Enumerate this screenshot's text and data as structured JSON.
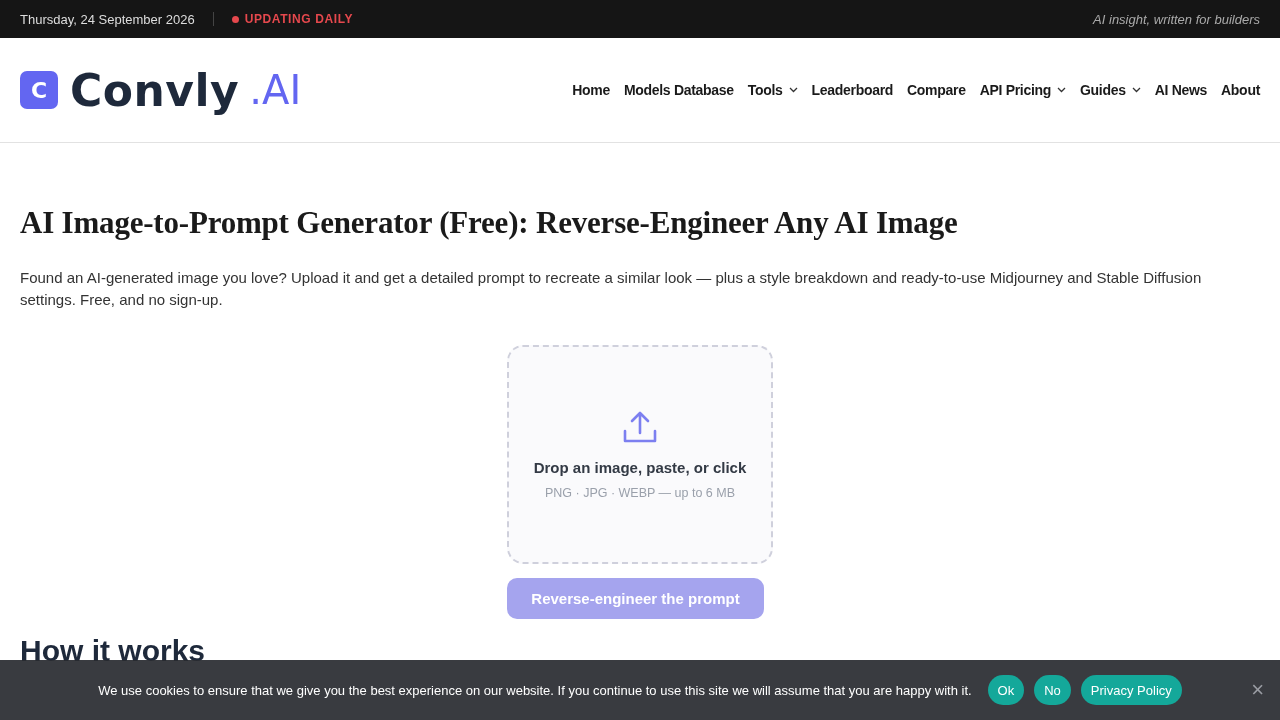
{
  "top_bar": {
    "date": "Thursday, 24 September 2026",
    "status": "UPDATING DAILY",
    "tagline": "AI insight, written for builders"
  },
  "header": {
    "logo": {
      "mark": "C",
      "name": "Convly",
      "suffix": ".AI"
    },
    "nav": [
      {
        "label": "Home",
        "dropdown": false
      },
      {
        "label": "Models Database",
        "dropdown": false
      },
      {
        "label": "Tools",
        "dropdown": true
      },
      {
        "label": "Leaderboard",
        "dropdown": false
      },
      {
        "label": "Compare",
        "dropdown": false
      },
      {
        "label": "API Pricing",
        "dropdown": true
      },
      {
        "label": "Guides",
        "dropdown": true
      },
      {
        "label": "AI News",
        "dropdown": false
      },
      {
        "label": "About",
        "dropdown": false
      }
    ]
  },
  "main": {
    "title": "AI Image-to-Prompt Generator (Free): Reverse-Engineer Any AI Image",
    "intro": "Found an AI-generated image you love? Upload it and get a detailed prompt to recreate a similar look — plus a style breakdown and ready-to-use Midjourney and Stable Diffusion settings. Free, and no sign-up.",
    "dropzone": {
      "label": "Drop an image, paste, or click",
      "hint": "PNG · JPG · WEBP — up to 6 MB"
    },
    "submit": {
      "label": "Reverse-engineer the prompt",
      "disabled": true
    },
    "section_heading": "How it works"
  },
  "cookie_bar": {
    "message": "We use cookies to ensure that we give you the best experience on our website. If you continue to use this site we will assume that you are happy with it.",
    "buttons": [
      "Ok",
      "No",
      "Privacy Policy"
    ],
    "close": "×"
  }
}
